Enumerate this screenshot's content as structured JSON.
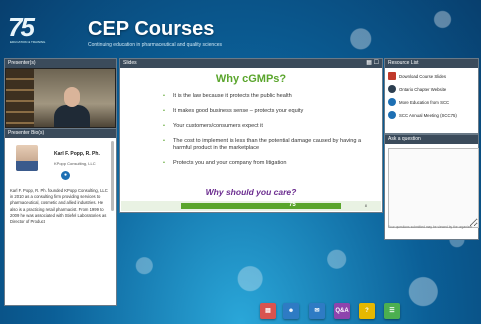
{
  "header": {
    "logo_text": "75",
    "logo_sub": "EDUCATION & TRAINING",
    "title": "CEP Courses",
    "subtitle": "Continuing education in pharmaceutical and quality sciences"
  },
  "presenters": {
    "title": "Presenter(s)"
  },
  "bio": {
    "title": "Presenter Bio(s)",
    "name": "Karl F. Popp, R. Ph.",
    "company": "KPopp Consulting, LLC",
    "text": "Karl F. Popp, R. Ph. founded KPopp Consulting, LLC in 2010 as a consulting firm providing services to pharmaceutical, cosmetic and allied industries. He also is a practicing retail pharmacist. From 1999 to 2009 he was associated with Stiefel Laboratories as Director of Product"
  },
  "slides": {
    "title": "Slides",
    "slide_title": "Why cGMPs?",
    "bullets": [
      "It is the law because it protects the public health",
      "It makes good business sense – protects your equity",
      "Your customers/consumers expect it",
      "The cost to implement is less than the potential damage caused by having a harmful product in the marketplace",
      "Protects you and your company from litigation"
    ],
    "question": "Why should you care?",
    "footer_logo": "75",
    "page_number": "8"
  },
  "resources": {
    "title": "Resource List",
    "items": [
      {
        "label": "Download Course Slides",
        "color": "#c0392b"
      },
      {
        "label": "Ontario Chapter Website",
        "color": "#2c3e50"
      },
      {
        "label": "More Education from SCC",
        "color": "#1d6fb3"
      },
      {
        "label": "SCC Annual Meeting (SCC75)",
        "color": "#1d6fb3"
      }
    ]
  },
  "ask": {
    "title": "Ask a question",
    "note": "Your questions submitted may be viewed by the organizer"
  },
  "toolbar": {
    "items": [
      {
        "name": "slides-tool",
        "label": "",
        "color": "#d9534f"
      },
      {
        "name": "people-tool",
        "label": "",
        "color": "#2e7bc4"
      },
      {
        "name": "chat-tool",
        "label": "",
        "color": "#2e7bc4"
      },
      {
        "name": "qa-tool",
        "label": "Q&A",
        "color": "#8e44ad"
      },
      {
        "name": "help-tool",
        "label": "?",
        "color": "#e6b800"
      },
      {
        "name": "resources-tool",
        "label": "",
        "color": "#4caf50"
      }
    ]
  }
}
